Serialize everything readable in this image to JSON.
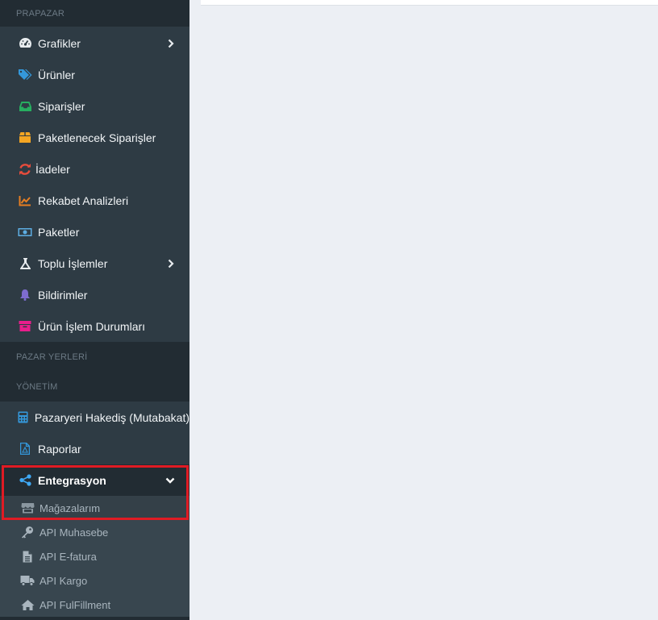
{
  "sidebar": {
    "sections": {
      "prapazar": "PRAPAZAR",
      "pazar_yerleri": "PAZAR YERLERİ",
      "yonetim": "YÖNETİM"
    },
    "items": [
      {
        "label": "Grafikler",
        "icon": "tachometer-icon",
        "color": "#e8ecef",
        "has_chevron": true
      },
      {
        "label": "Ürünler",
        "icon": "tags-icon",
        "color": "#3498db"
      },
      {
        "label": "Siparişler",
        "icon": "inbox-icon",
        "color": "#27ae60"
      },
      {
        "label": "Paketlenecek Siparişler",
        "icon": "box-icon",
        "color": "#f5a623"
      },
      {
        "label": "İadeler",
        "icon": "sync-icon",
        "color": "#e74c3c"
      },
      {
        "label": "Rekabet Analizleri",
        "icon": "chart-line-icon",
        "color": "#e67e22"
      },
      {
        "label": "Paketler",
        "icon": "money-bill-icon",
        "color": "#5dade2"
      },
      {
        "label": "Toplu İşlemler",
        "icon": "flask-icon",
        "color": "#e8ecef",
        "has_chevron": true
      },
      {
        "label": "Bildirimler",
        "icon": "bell-icon",
        "color": "#7e6ccf"
      },
      {
        "label": "Ürün İşlem Durumları",
        "icon": "archive-icon",
        "color": "#e91e8c"
      }
    ],
    "management": [
      {
        "label": "Pazaryeri Hakediş (Mutabakat)",
        "icon": "calculator-icon",
        "color": "#3498db"
      },
      {
        "label": "Raporlar",
        "icon": "file-pdf-icon",
        "color": "#3498db"
      },
      {
        "label": "Entegrasyon",
        "icon": "share-alt-icon",
        "color": "#3fa9f5",
        "expanded": true
      }
    ],
    "sub_items": [
      {
        "label": "Mağazalarım",
        "icon": "store-icon"
      },
      {
        "label": "API Muhasebe",
        "icon": "key-icon"
      },
      {
        "label": "API E-fatura",
        "icon": "file-alt-icon"
      },
      {
        "label": "API Kargo",
        "icon": "truck-icon"
      },
      {
        "label": "API FulFillment",
        "icon": "home-icon"
      }
    ]
  },
  "colors": {
    "sidebar_bg": "#2e3b44",
    "section_bg": "#222c33",
    "highlight": "#e01b24",
    "main_bg": "#eceff4"
  }
}
